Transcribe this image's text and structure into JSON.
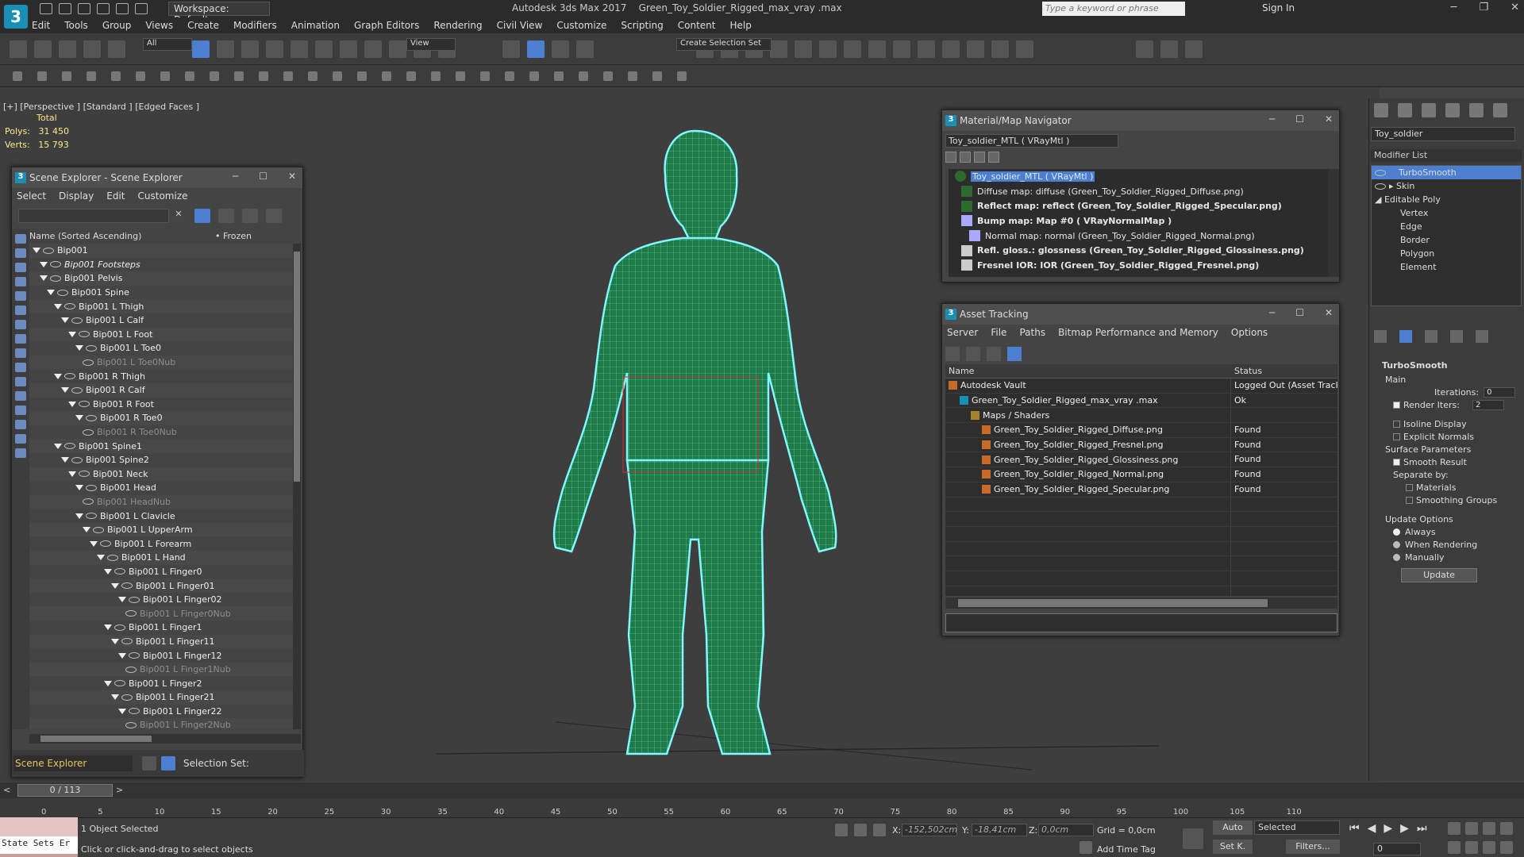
{
  "app": {
    "title": "Autodesk 3ds Max 2017",
    "file": "Green_Toy_Soldier_Rigged_max_vray .max",
    "workspace": "Workspace: Default",
    "search_placeholder": "Type a keyword or phrase",
    "signin": "Sign In",
    "logo": "3"
  },
  "menu": [
    "Edit",
    "Tools",
    "Group",
    "Views",
    "Create",
    "Modifiers",
    "Animation",
    "Graph Editors",
    "Rendering",
    "Civil View",
    "Customize",
    "Scripting",
    "Content",
    "Help"
  ],
  "toolbar": {
    "selection_filter": "All",
    "ref_coord": "View",
    "named_sel": "Create Selection Set"
  },
  "viewport": {
    "label": "[+] [Perspective ] [Standard ] [Edged Faces ]",
    "stats_total": "Total",
    "polys_label": "Polys:",
    "polys": "31 450",
    "verts_label": "Verts:",
    "verts": "15 793"
  },
  "scene_explorer": {
    "title": "Scene Explorer - Scene Explorer",
    "menu": [
      "Select",
      "Display",
      "Edit",
      "Customize"
    ],
    "col_name": "Name (Sorted Ascending)",
    "col_frozen": "• Frozen",
    "footer_name": "Scene Explorer",
    "footer_selset": "Selection Set:",
    "rows": [
      {
        "t": "Bip001",
        "d": 0,
        "s": ""
      },
      {
        "t": "Bip001 Footsteps",
        "d": 1,
        "s": "ital"
      },
      {
        "t": "Bip001 Pelvis",
        "d": 1,
        "s": ""
      },
      {
        "t": "Bip001 Spine",
        "d": 2,
        "s": ""
      },
      {
        "t": "Bip001 L Thigh",
        "d": 3,
        "s": ""
      },
      {
        "t": "Bip001 L Calf",
        "d": 4,
        "s": ""
      },
      {
        "t": "Bip001 L Foot",
        "d": 5,
        "s": ""
      },
      {
        "t": "Bip001 L Toe0",
        "d": 6,
        "s": ""
      },
      {
        "t": "Bip001 L Toe0Nub",
        "d": 7,
        "s": "dim"
      },
      {
        "t": "Bip001 R Thigh",
        "d": 3,
        "s": ""
      },
      {
        "t": "Bip001 R Calf",
        "d": 4,
        "s": ""
      },
      {
        "t": "Bip001 R Foot",
        "d": 5,
        "s": ""
      },
      {
        "t": "Bip001 R Toe0",
        "d": 6,
        "s": ""
      },
      {
        "t": "Bip001 R Toe0Nub",
        "d": 7,
        "s": "dim"
      },
      {
        "t": "Bip001 Spine1",
        "d": 3,
        "s": ""
      },
      {
        "t": "Bip001 Spine2",
        "d": 4,
        "s": ""
      },
      {
        "t": "Bip001 Neck",
        "d": 5,
        "s": ""
      },
      {
        "t": "Bip001 Head",
        "d": 6,
        "s": ""
      },
      {
        "t": "Bip001 HeadNub",
        "d": 7,
        "s": "dim"
      },
      {
        "t": "Bip001 L Clavicle",
        "d": 6,
        "s": ""
      },
      {
        "t": "Bip001 L UpperArm",
        "d": 7,
        "s": ""
      },
      {
        "t": "Bip001 L Forearm",
        "d": 8,
        "s": ""
      },
      {
        "t": "Bip001 L Hand",
        "d": 9,
        "s": ""
      },
      {
        "t": "Bip001 L Finger0",
        "d": 10,
        "s": ""
      },
      {
        "t": "Bip001 L Finger01",
        "d": 11,
        "s": ""
      },
      {
        "t": "Bip001 L Finger02",
        "d": 12,
        "s": ""
      },
      {
        "t": "Bip001 L Finger0Nub",
        "d": 13,
        "s": "dim"
      },
      {
        "t": "Bip001 L Finger1",
        "d": 10,
        "s": ""
      },
      {
        "t": "Bip001 L Finger11",
        "d": 11,
        "s": ""
      },
      {
        "t": "Bip001 L Finger12",
        "d": 12,
        "s": ""
      },
      {
        "t": "Bip001 L Finger1Nub",
        "d": 13,
        "s": "dim"
      },
      {
        "t": "Bip001 L Finger2",
        "d": 10,
        "s": ""
      },
      {
        "t": "Bip001 L Finger21",
        "d": 11,
        "s": ""
      },
      {
        "t": "Bip001 L Finger22",
        "d": 12,
        "s": ""
      },
      {
        "t": "Bip001 L Finger2Nub",
        "d": 13,
        "s": "dim"
      }
    ]
  },
  "material_nav": {
    "title": "Material/Map Navigator",
    "field": "Toy_soldier_MTL  ( VRayMtl )",
    "rows": [
      {
        "t": "Toy_soldier_MTL  ( VRayMtl )",
        "b": false,
        "sel": true
      },
      {
        "t": "Diffuse map: diffuse (Green_Toy_Soldier_Rigged_Diffuse.png)",
        "b": false,
        "sel": false
      },
      {
        "t": "Reflect map: reflect (Green_Toy_Soldier_Rigged_Specular.png)",
        "b": true,
        "sel": false
      },
      {
        "t": "Bump map: Map #0  ( VRayNormalMap )",
        "b": true,
        "sel": false
      },
      {
        "t": "Normal map: normal (Green_Toy_Soldier_Rigged_Normal.png)",
        "b": false,
        "sel": false
      },
      {
        "t": "Refl. gloss.: glossness (Green_Toy_Soldier_Rigged_Glossiness.png)",
        "b": true,
        "sel": false
      },
      {
        "t": "Fresnel IOR: IOR (Green_Toy_Soldier_Rigged_Fresnel.png)",
        "b": true,
        "sel": false
      }
    ]
  },
  "asset_tracking": {
    "title": "Asset Tracking",
    "menu": [
      "Server",
      "File",
      "Paths",
      "Bitmap Performance and Memory",
      "Options"
    ],
    "col_name": "Name",
    "col_status": "Status",
    "rows": [
      {
        "n": "Autodesk Vault",
        "s": "Logged Out (Asset Tracki",
        "d": 0
      },
      {
        "n": "Green_Toy_Soldier_Rigged_max_vray .max",
        "s": "Ok",
        "d": 1
      },
      {
        "n": "Maps / Shaders",
        "s": "",
        "d": 2
      },
      {
        "n": "Green_Toy_Soldier_Rigged_Diffuse.png",
        "s": "Found",
        "d": 3
      },
      {
        "n": "Green_Toy_Soldier_Rigged_Fresnel.png",
        "s": "Found",
        "d": 3
      },
      {
        "n": "Green_Toy_Soldier_Rigged_Glossiness.png",
        "s": "Found",
        "d": 3
      },
      {
        "n": "Green_Toy_Soldier_Rigged_Normal.png",
        "s": "Found",
        "d": 3
      },
      {
        "n": "Green_Toy_Soldier_Rigged_Specular.png",
        "s": "Found",
        "d": 3
      }
    ]
  },
  "command_panel": {
    "object_name": "Toy_soldier",
    "modifier_list": "Modifier List",
    "stack": [
      {
        "t": "TurboSmooth",
        "sel": true
      },
      {
        "t": "▸ Skin",
        "sel": false
      },
      {
        "t": "◢ Editable Poly",
        "sel": false
      },
      {
        "t": "Vertex",
        "sel": false
      },
      {
        "t": "Edge",
        "sel": false
      },
      {
        "t": "Border",
        "sel": false
      },
      {
        "t": "Polygon",
        "sel": false
      },
      {
        "t": "Element",
        "sel": false
      }
    ],
    "rollout": "TurboSmooth",
    "main": "Main",
    "iterations_label": "Iterations:",
    "iterations": "0",
    "render_iters_label": "Render Iters:",
    "render_iters": "2",
    "isoline": "Isoline Display",
    "explicit_normals": "Explicit Normals",
    "surface_params": "Surface Parameters",
    "smooth_result": "Smooth Result",
    "separate_by": "Separate by:",
    "materials": "Materials",
    "smoothing_groups": "Smoothing Groups",
    "update_options": "Update Options",
    "always": "Always",
    "when_rendering": "When Rendering",
    "manually": "Manually",
    "update_btn": "Update"
  },
  "timeline": {
    "frame": "0 / 113",
    "ticks": [
      "0",
      "5",
      "10",
      "15",
      "20",
      "25",
      "30",
      "35",
      "40",
      "45",
      "50",
      "55",
      "60",
      "65",
      "70",
      "75",
      "80",
      "85",
      "90",
      "95",
      "100",
      "105",
      "110"
    ]
  },
  "status": {
    "selected": "1 Object Selected",
    "prompt": "Click or click-and-drag to select objects",
    "x_label": "X:",
    "x": "-152,502cm",
    "y_label": "Y:",
    "y": "-18,41cm",
    "z_label": "Z:",
    "z": "0,0cm",
    "grid": "Grid = 0,0cm",
    "add_time_tag": "Add Time Tag",
    "auto": "Auto",
    "setk": "Set K.",
    "selected_dd": "Selected",
    "filters": "Filters...",
    "frame_field": "0",
    "maxscript": "State Sets Er"
  }
}
